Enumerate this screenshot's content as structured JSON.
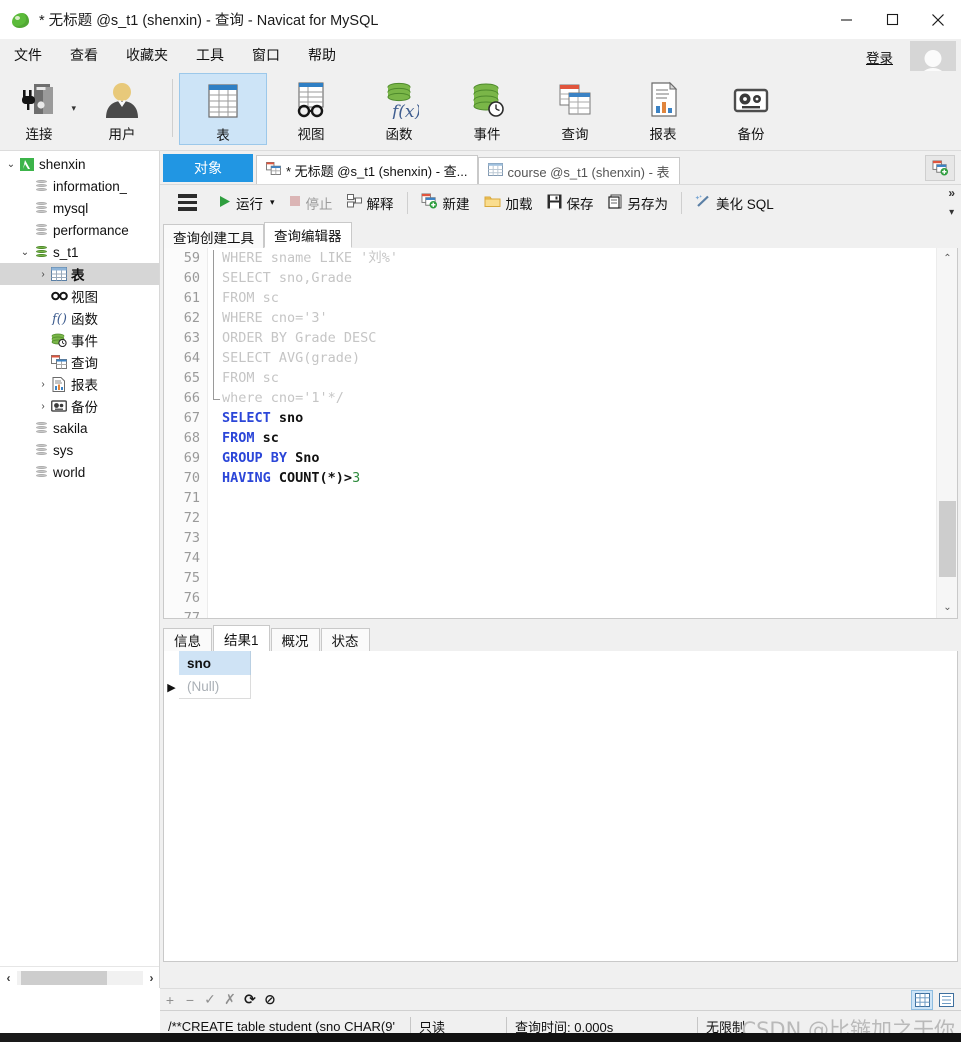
{
  "window": {
    "title": "* 无标题 @s_t1 (shenxin) - 查询 - Navicat for MySQL",
    "logo_icon": "navicat-leaf-logo",
    "minimize_icon": "minimize-icon",
    "maximize_icon": "maximize-icon",
    "close_icon": "close-icon"
  },
  "menubar": {
    "items": [
      {
        "label": "文件"
      },
      {
        "label": "查看"
      },
      {
        "label": "收藏夹"
      },
      {
        "label": "工具"
      },
      {
        "label": "窗口"
      },
      {
        "label": "帮助"
      }
    ],
    "login_label": "登录",
    "avatar_icon": "user-avatar-icon",
    "overflow_icon": "chevron-double-right-icon"
  },
  "toolbar": {
    "buttons": [
      {
        "label": "连接",
        "icon": "connection-icon",
        "has_dropdown": true,
        "active": false
      },
      {
        "label": "用户",
        "icon": "user-icon",
        "has_dropdown": false,
        "active": false
      },
      {
        "label": "表",
        "icon": "table-icon",
        "has_dropdown": false,
        "active": true
      },
      {
        "label": "视图",
        "icon": "view-icon",
        "has_dropdown": false,
        "active": false
      },
      {
        "label": "函数",
        "icon": "function-icon",
        "has_dropdown": false,
        "active": false
      },
      {
        "label": "事件",
        "icon": "event-icon",
        "has_dropdown": false,
        "active": false
      },
      {
        "label": "查询",
        "icon": "query-icon",
        "has_dropdown": false,
        "active": false
      },
      {
        "label": "报表",
        "icon": "report-icon",
        "has_dropdown": false,
        "active": false
      },
      {
        "label": "备份",
        "icon": "backup-icon",
        "has_dropdown": false,
        "active": false
      }
    ],
    "overflow_icon": "chevron-double-right-icon",
    "more_icon": "chevron-down-icon"
  },
  "sidebar": {
    "tree": [
      {
        "label": "shenxin",
        "icon": "navicat-connection-icon",
        "indent": 0,
        "twisty": "expanded",
        "selected": false
      },
      {
        "label": "information_",
        "icon": "database-icon",
        "indent": 1,
        "twisty": "none",
        "selected": false
      },
      {
        "label": "mysql",
        "icon": "database-icon",
        "indent": 1,
        "twisty": "none",
        "selected": false
      },
      {
        "label": "performance",
        "icon": "database-icon",
        "indent": 1,
        "twisty": "none",
        "selected": false
      },
      {
        "label": "s_t1",
        "icon": "database-open-icon",
        "indent": 1,
        "twisty": "expanded",
        "selected": false
      },
      {
        "label": "表",
        "icon": "table-icon",
        "indent": 2,
        "twisty": "collapsed",
        "selected": true
      },
      {
        "label": "视图",
        "icon": "view-icon",
        "indent": 2,
        "twisty": "none",
        "selected": false
      },
      {
        "label": "函数",
        "icon": "function-icon",
        "indent": 2,
        "twisty": "none",
        "selected": false
      },
      {
        "label": "事件",
        "icon": "event-icon",
        "indent": 2,
        "twisty": "none",
        "selected": false
      },
      {
        "label": "查询",
        "icon": "query-icon",
        "indent": 2,
        "twisty": "none",
        "selected": false
      },
      {
        "label": "报表",
        "icon": "report-icon",
        "indent": 2,
        "twisty": "collapsed",
        "selected": false
      },
      {
        "label": "备份",
        "icon": "backup-icon",
        "indent": 2,
        "twisty": "collapsed",
        "selected": false
      },
      {
        "label": "sakila",
        "icon": "database-icon",
        "indent": 1,
        "twisty": "none",
        "selected": false
      },
      {
        "label": "sys",
        "icon": "database-icon",
        "indent": 1,
        "twisty": "none",
        "selected": false
      },
      {
        "label": "world",
        "icon": "database-icon",
        "indent": 1,
        "twisty": "none",
        "selected": false
      }
    ],
    "scroll_left_icon": "chevron-left-icon",
    "scroll_right_icon": "chevron-right-icon"
  },
  "tabstrip": {
    "object_tab": "对象",
    "tabs": [
      {
        "label": "* 无标题 @s_t1 (shenxin) - 查...",
        "icon": "query-icon",
        "active": true
      },
      {
        "label": "course @s_t1 (shenxin) - 表",
        "icon": "table-icon",
        "active": false
      }
    ],
    "add_tab_icon": "add-tab-icon"
  },
  "query_toolbar": {
    "menu_icon": "hamburger-menu-icon",
    "buttons": [
      {
        "label": "运行",
        "icon": "play-icon",
        "disabled": false,
        "has_dropdown": true
      },
      {
        "label": "停止",
        "icon": "stop-icon",
        "disabled": true,
        "has_dropdown": false
      },
      {
        "label": "解释",
        "icon": "explain-icon",
        "disabled": false,
        "has_dropdown": false
      },
      {
        "label": "新建",
        "icon": "new-icon",
        "disabled": false,
        "has_dropdown": false
      },
      {
        "label": "加载",
        "icon": "folder-icon",
        "disabled": false,
        "has_dropdown": false
      },
      {
        "label": "保存",
        "icon": "save-icon",
        "disabled": false,
        "has_dropdown": false
      },
      {
        "label": "另存为",
        "icon": "save-as-icon",
        "disabled": false,
        "has_dropdown": false
      },
      {
        "label": "美化 SQL",
        "icon": "beautify-icon",
        "disabled": false,
        "has_dropdown": false
      }
    ],
    "overflow_icon": "chevron-double-right-icon"
  },
  "sub_tabs": [
    {
      "label": "查询创建工具",
      "active": false
    },
    {
      "label": "查询编辑器",
      "active": true
    }
  ],
  "editor": {
    "lines": [
      {
        "num": "59",
        "segments": [
          {
            "t": "WHERE sname LIKE '刘%'",
            "c": "cmt"
          }
        ]
      },
      {
        "num": "60",
        "segments": [
          {
            "t": "SELECT sno,Grade",
            "c": "cmt"
          }
        ]
      },
      {
        "num": "61",
        "segments": [
          {
            "t": "FROM sc",
            "c": "cmt"
          }
        ]
      },
      {
        "num": "62",
        "segments": [
          {
            "t": "WHERE cno='3'",
            "c": "cmt"
          }
        ]
      },
      {
        "num": "63",
        "segments": [
          {
            "t": "ORDER BY Grade DESC",
            "c": "cmt"
          }
        ]
      },
      {
        "num": "64",
        "segments": [
          {
            "t": "SELECT AVG(grade)",
            "c": "cmt"
          }
        ]
      },
      {
        "num": "65",
        "segments": [
          {
            "t": "FROM sc",
            "c": "cmt"
          }
        ]
      },
      {
        "num": "66",
        "segments": [
          {
            "t": "where cno='1'*/",
            "c": "cmt"
          }
        ]
      },
      {
        "num": "67",
        "segments": [
          {
            "t": "SELECT ",
            "c": "kw"
          },
          {
            "t": "sno",
            "c": "id"
          }
        ]
      },
      {
        "num": "68",
        "segments": [
          {
            "t": "FROM ",
            "c": "kw"
          },
          {
            "t": "sc",
            "c": "id"
          }
        ]
      },
      {
        "num": "69",
        "segments": [
          {
            "t": "GROUP BY ",
            "c": "kw"
          },
          {
            "t": "Sno",
            "c": "id"
          }
        ]
      },
      {
        "num": "70",
        "segments": [
          {
            "t": "HAVING ",
            "c": "kw"
          },
          {
            "t": "COUNT(*)>",
            "c": "id"
          },
          {
            "t": "3",
            "c": "num"
          }
        ]
      },
      {
        "num": "71",
        "segments": []
      },
      {
        "num": "72",
        "segments": []
      },
      {
        "num": "73",
        "segments": []
      },
      {
        "num": "74",
        "segments": []
      },
      {
        "num": "75",
        "segments": []
      },
      {
        "num": "76",
        "segments": []
      },
      {
        "num": "77",
        "segments": []
      }
    ],
    "scroll_up_icon": "chevron-up-icon",
    "scroll_down_icon": "chevron-down-icon"
  },
  "result_tabs": [
    {
      "label": "信息",
      "active": false
    },
    {
      "label": "结果1",
      "active": true
    },
    {
      "label": "概况",
      "active": false
    },
    {
      "label": "状态",
      "active": false
    }
  ],
  "result_grid": {
    "columns": [
      "sno"
    ],
    "rows": [
      {
        "current": true,
        "cells": [
          "(Null)"
        ]
      }
    ],
    "row_marker_icon": "current-row-arrow-icon"
  },
  "action_bar": {
    "buttons": [
      {
        "icon": "plus-icon",
        "glyph": "+",
        "disabled": true
      },
      {
        "icon": "minus-icon",
        "glyph": "−",
        "disabled": true
      },
      {
        "icon": "check-icon",
        "glyph": "✓",
        "disabled": true
      },
      {
        "icon": "cancel-icon",
        "glyph": "✗",
        "disabled": true
      },
      {
        "icon": "refresh-icon",
        "glyph": "⟳",
        "disabled": false
      },
      {
        "icon": "stop-circle-icon",
        "glyph": "⊘",
        "disabled": false
      }
    ],
    "views": [
      {
        "icon": "grid-view-icon",
        "active": true
      },
      {
        "icon": "form-view-icon",
        "active": false
      }
    ]
  },
  "statusbar": {
    "sql_preview": "/**CREATE table student (sno CHAR(9'",
    "readonly": "只读",
    "query_time": "查询时间: 0.000s",
    "limit": "无限制",
    "watermark": "CSDN @比镞加之干你"
  },
  "colors": {
    "accent_blue": "#2196e3",
    "tab_active_bg": "#cde4f7",
    "grid_header_bg": "#cfe3f5",
    "keyword_blue": "#2b46d8",
    "number_green": "#2e8b3d",
    "comment_grey": "#c5c5c5",
    "toolbar_bg": "#f0f0f0"
  }
}
